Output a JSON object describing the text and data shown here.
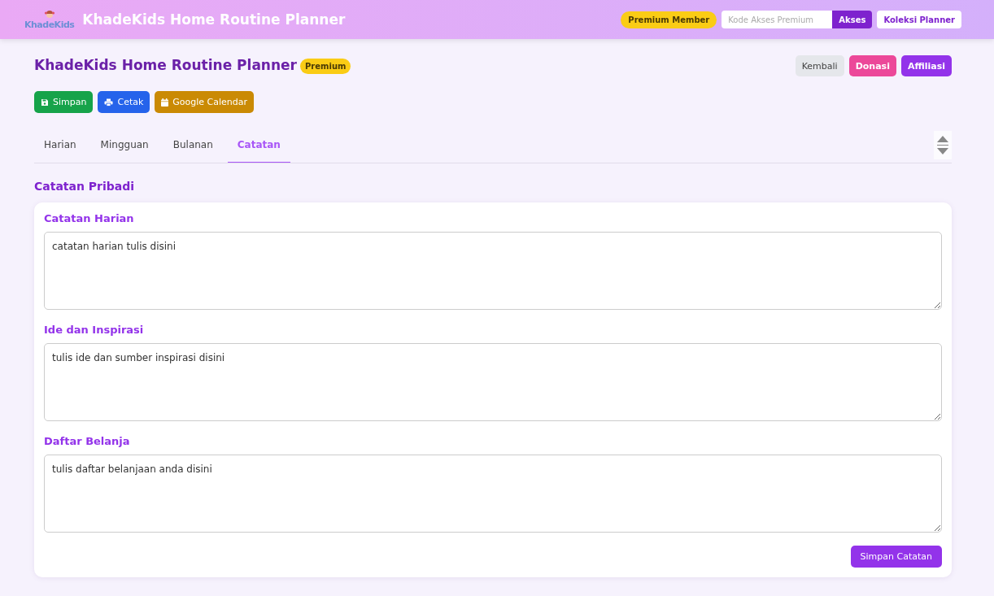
{
  "header": {
    "logo_text": "KhadeKids",
    "title": "KhadeKids Home Routine Planner",
    "member_badge": "Premium Member",
    "access_field": {
      "placeholder": "Kode Akses Premium"
    },
    "access_button": "Akses",
    "collection_button": "Koleksi Planner"
  },
  "page": {
    "title": "KhadeKids Home Routine Planner",
    "badge": "Premium",
    "nav_buttons": [
      {
        "label": "Kembali",
        "kind": "neutral"
      },
      {
        "label": "Donasi",
        "kind": "pink"
      },
      {
        "label": "Affiliasi",
        "kind": "purple"
      }
    ],
    "actions": [
      {
        "label": "Simpan",
        "kind": "save"
      },
      {
        "label": "Cetak",
        "kind": "print"
      },
      {
        "label": "Google Calendar",
        "kind": "calendar"
      }
    ]
  },
  "tabs": [
    {
      "label": "Harian",
      "selected": false
    },
    {
      "label": "Mingguan",
      "selected": false
    },
    {
      "label": "Bulanan",
      "selected": false
    },
    {
      "label": "Catatan",
      "selected": true
    }
  ],
  "section_title": "Catatan Pribadi",
  "notes": [
    {
      "title": "Catatan Harian",
      "value": "catatan harian tulis disini"
    },
    {
      "title": "Ide dan Inspirasi",
      "value": "tulis ide dan sumber inspirasi disini"
    },
    {
      "title": "Daftar Belanja",
      "value": "tulis daftar belanjaan anda disini"
    }
  ],
  "save_button": "Simpan Catatan"
}
